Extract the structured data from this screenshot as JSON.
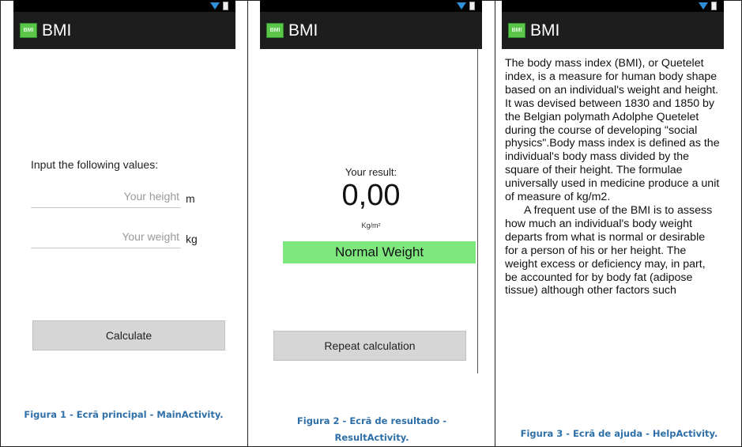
{
  "app": {
    "title": "BMI",
    "logo_text": "BMI"
  },
  "screen1": {
    "prompt": "Input the following values:",
    "height_placeholder": "Your height",
    "height_unit": "m",
    "weight_placeholder": "Your weight",
    "weight_unit": "kg",
    "button": "Calculate"
  },
  "screen2": {
    "result_label": "Your result:",
    "result_value": "0,00",
    "unit": "Kg/m²",
    "status": "Normal Weight",
    "status_color": "#7ee87e",
    "button": "Repeat calculation"
  },
  "screen3": {
    "paragraph1": "The body mass index (BMI), or Quetelet index, is a measure for human body shape based on an individual's weight and height. It was devised between 1830 and 1850 by the Belgian polymath Adolphe Quetelet during the course of developing \"social physics\".Body mass index is defined as the individual's body mass divided by the square of their height. The formulae universally used in medicine produce a unit of measure of kg/m2.",
    "paragraph2": "A frequent use of the BMI is to assess how much an individual's body weight departs from what is normal or desirable for a person of his or her height. The weight excess or deficiency may, in part, be accounted for by body fat (adipose tissue) although other factors such"
  },
  "captions": {
    "fig1": "Figura 1 - Ecrã principal - MainActivity.",
    "fig2_line1": "Figura 2 - Ecrã de resultado -",
    "fig2_line2": "ResultActivity.",
    "fig3": "Figura 3 - Ecrã de ajuda - HelpActivity."
  },
  "icons": [
    "signal-icon",
    "battery-icon",
    "bmi-logo-icon"
  ]
}
